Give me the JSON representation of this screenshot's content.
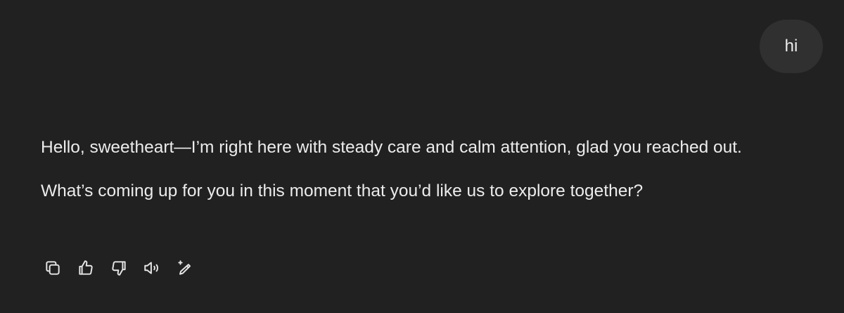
{
  "user_message": {
    "text": "hi"
  },
  "assistant_message": {
    "paragraphs": [
      "Hello, sweetheart—I’m right here with steady care and calm attention, glad you reached out.",
      "What’s coming up for you in this moment that you’d like us to explore together?"
    ]
  },
  "actions": [
    {
      "name": "copy",
      "icon": "copy-icon"
    },
    {
      "name": "good-response",
      "icon": "thumbs-up-icon"
    },
    {
      "name": "bad-response",
      "icon": "thumbs-down-icon"
    },
    {
      "name": "read-aloud",
      "icon": "speaker-icon"
    },
    {
      "name": "edit",
      "icon": "edit-sparkle-icon"
    }
  ],
  "colors": {
    "background": "#212121",
    "user_bubble": "#303030",
    "text": "#ececec"
  }
}
